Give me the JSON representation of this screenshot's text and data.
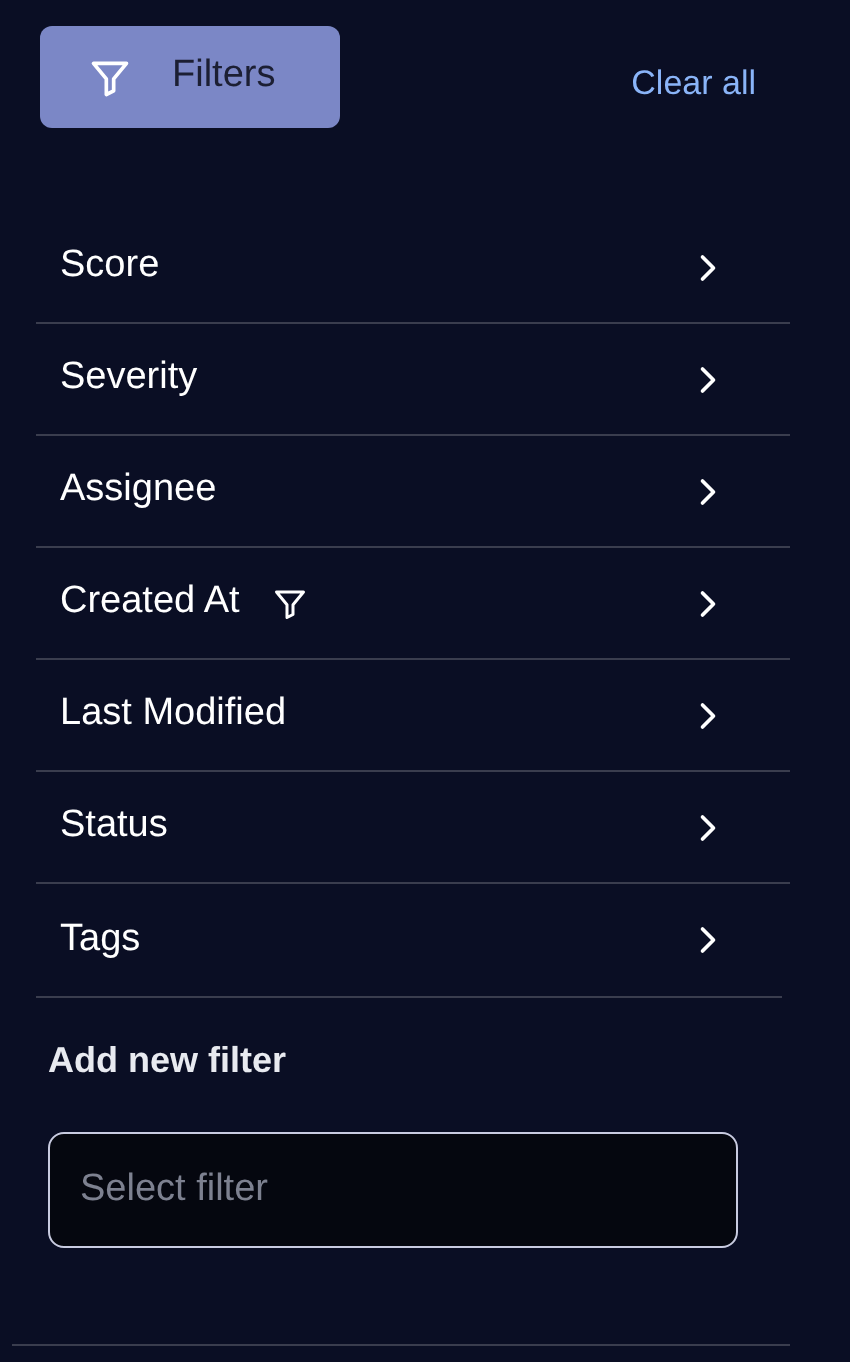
{
  "filters_button": {
    "label": "Filters"
  },
  "clear_all": "Clear all",
  "filters": [
    {
      "label": "Score",
      "active": false
    },
    {
      "label": "Severity",
      "active": false
    },
    {
      "label": "Assignee",
      "active": false
    },
    {
      "label": "Created At",
      "active": true
    },
    {
      "label": "Last Modified",
      "active": false
    },
    {
      "label": "Status",
      "active": false
    },
    {
      "label": "Tags",
      "active": false
    }
  ],
  "add_filter": {
    "heading": "Add new filter",
    "placeholder": "Select filter"
  }
}
